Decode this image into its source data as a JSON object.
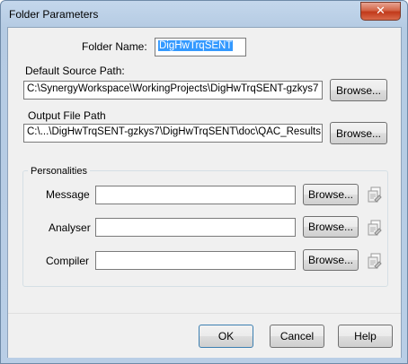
{
  "window": {
    "title": "Folder Parameters",
    "close_glyph": "✕"
  },
  "folder": {
    "label": "Folder Name:",
    "value": "DigHwTrqSENT"
  },
  "source_path": {
    "label": "Default Source Path:",
    "value": "C:\\SynergyWorkspace\\WorkingProjects\\DigHwTrqSENT-gzkys7",
    "browse_label": "Browse..."
  },
  "output_path": {
    "label": "Output File Path",
    "value": "C:\\...\\DigHwTrqSENT-gzkys7\\DigHwTrqSENT\\doc\\QAC_Results",
    "browse_label": "Browse..."
  },
  "personalities": {
    "title": "Personalities",
    "rows": [
      {
        "label": "Message",
        "value": "",
        "browse_label": "Browse...",
        "icon": "edit-document-icon"
      },
      {
        "label": "Analyser",
        "value": "",
        "browse_label": "Browse...",
        "icon": "edit-document-icon"
      },
      {
        "label": "Compiler",
        "value": "",
        "browse_label": "Browse...",
        "icon": "edit-document-icon"
      }
    ]
  },
  "buttons": {
    "ok": "OK",
    "cancel": "Cancel",
    "help": "Help"
  },
  "colors": {
    "selection": "#3399ff",
    "frame": "#b9cee6",
    "close": "#c1391a"
  }
}
